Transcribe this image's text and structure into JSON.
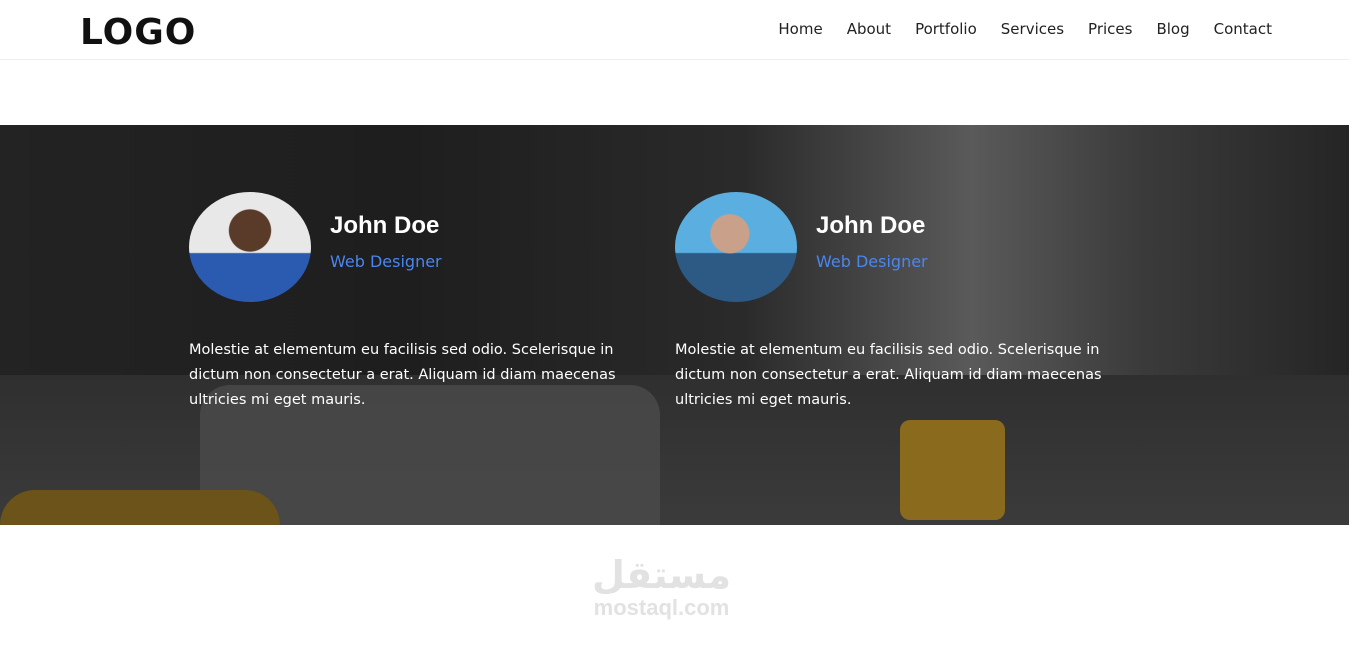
{
  "header": {
    "logo": "LOGO",
    "nav": [
      "Home",
      "About",
      "Portfolio",
      "Services",
      "Prices",
      "Blog",
      "Contact"
    ]
  },
  "team": [
    {
      "name": "John Doe",
      "role": "Web Designer",
      "bio": "Molestie at elementum eu facilisis sed odio. Scelerisque in dictum non consectetur a erat. Aliquam id diam maecenas ultricies mi eget mauris."
    },
    {
      "name": "John Doe",
      "role": "Web Designer",
      "bio": "Molestie at elementum eu facilisis sed odio. Scelerisque in dictum non consectetur a erat. Aliquam id diam maecenas ultricies mi eget mauris."
    }
  ],
  "watermark": {
    "arabic": "مستقل",
    "latin": "mostaql.com"
  },
  "colors": {
    "accent": "#4a86f0"
  }
}
